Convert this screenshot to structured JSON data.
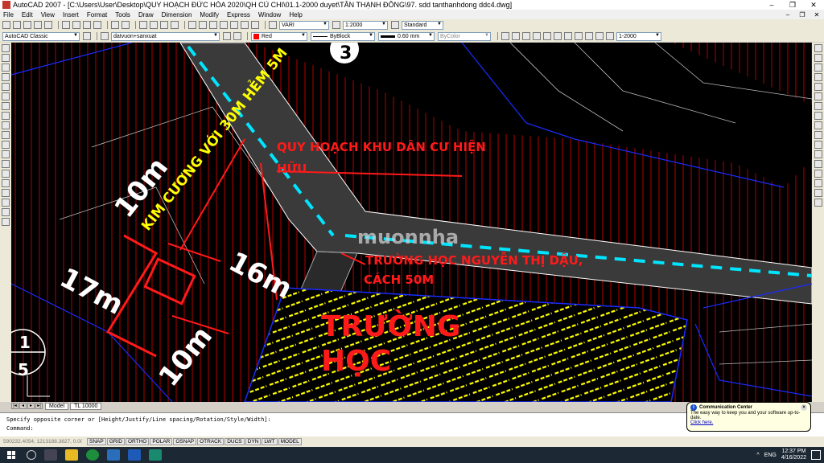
{
  "window": {
    "title": "AutoCAD 2007 - [C:\\Users\\User\\Desktop\\QUY HOẠCH ĐỨC HÒA 2020\\QH CỦ CHI\\01.1-2000 duyet\\TÂN THẠNH ĐÔNG\\97. sdd tanthanhdong ddc4.dwg]",
    "minimize": "–",
    "maximize": "❐",
    "close": "✕"
  },
  "menu": [
    "File",
    "Edit",
    "View",
    "Insert",
    "Format",
    "Tools",
    "Draw",
    "Dimension",
    "Modify",
    "Express",
    "Window",
    "Help"
  ],
  "toolbar": {
    "text_style": "VARI",
    "scale": "1:2000",
    "dim_style": "Standard",
    "workspace": "AutoCAD Classic",
    "layer": "datvuon+sanxuat",
    "color": "Red",
    "linetype": "ByBlock",
    "lineweight": "0.60 mm",
    "plotstyle": "ByColor",
    "scale2": "1-2000"
  },
  "drawing": {
    "title_annotation_line1": "QUY HOẠCH KHU DÂN CƯ HIỆN",
    "title_annotation_line2": "HỮU",
    "school_note_line1": "TRƯỜNG HỌC NGUYỄN THỊ DẬU,",
    "school_note_line2": "CÁCH 50M",
    "school_label_line1": "TRƯỜNG",
    "school_label_line2": "HỌC",
    "alley_note": "KIM CƯƠNG VỚI 30M HẺM 5M",
    "dim_10m_top": "10m",
    "dim_16m": "16m",
    "dim_17m": "17m",
    "dim_10m_bottom": "10m",
    "watermark": "muonnha",
    "circle_top": "3",
    "circle_left_top": "1",
    "circle_left_bottom": "5"
  },
  "colors": {
    "road_fill": "#3a3a3a",
    "lot_lines": "#ff0000",
    "boundary": "#1a2bff",
    "center_line": "#00e5ff",
    "hatch": "#ffff00",
    "annotation_red": "#ff1a1a"
  },
  "layout_tabs": {
    "model": "Model",
    "layout": "TL 10000"
  },
  "command": {
    "history": "Specify opposite corner or [Height/Justify/Line spacing/Rotation/Style/Width]:",
    "prompt": "Command:"
  },
  "status": {
    "coords": "590232.4054, 1213188.3827, 0.0000",
    "toggles": [
      "SNAP",
      "GRID",
      "ORTHO",
      "POLAR",
      "OSNAP",
      "OTRACK",
      "DUCS",
      "DYN",
      "LWT",
      "MODEL"
    ]
  },
  "notification": {
    "title": "Communication Center",
    "body": "The easy way to keep you and your software up-to-date.",
    "link": "Click here."
  },
  "taskbar": {
    "lang": "ENG",
    "time": "12:37 PM",
    "date": "4/16/2022"
  }
}
